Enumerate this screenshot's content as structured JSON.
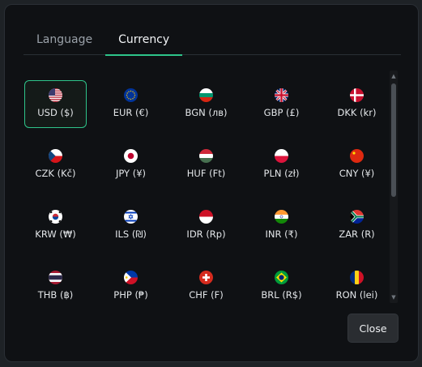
{
  "tabs": [
    {
      "label": "Language",
      "active": false
    },
    {
      "label": "Currency",
      "active": true
    }
  ],
  "accent_color": "#2ec48a",
  "currencies": [
    {
      "code": "USD ($)",
      "flag": "us-flag-icon",
      "selected": true
    },
    {
      "code": "EUR (€)",
      "flag": "eu-flag-icon"
    },
    {
      "code": "BGN (лв)",
      "flag": "bg-flag-icon"
    },
    {
      "code": "GBP (£)",
      "flag": "gb-flag-icon"
    },
    {
      "code": "DKK (kr)",
      "flag": "dk-flag-icon"
    },
    {
      "code": "CZK (Kč)",
      "flag": "cz-flag-icon"
    },
    {
      "code": "JPY (¥)",
      "flag": "jp-flag-icon"
    },
    {
      "code": "HUF (Ft)",
      "flag": "hu-flag-icon"
    },
    {
      "code": "PLN (zł)",
      "flag": "pl-flag-icon"
    },
    {
      "code": "CNY (¥)",
      "flag": "cn-flag-icon"
    },
    {
      "code": "KRW (₩)",
      "flag": "kr-flag-icon"
    },
    {
      "code": "ILS (₪)",
      "flag": "il-flag-icon"
    },
    {
      "code": "IDR (Rp)",
      "flag": "id-flag-icon"
    },
    {
      "code": "INR (₹)",
      "flag": "in-flag-icon"
    },
    {
      "code": "ZAR (R)",
      "flag": "za-flag-icon"
    },
    {
      "code": "THB (฿)",
      "flag": "th-flag-icon"
    },
    {
      "code": "PHP (₱)",
      "flag": "ph-flag-icon"
    },
    {
      "code": "CHF (F)",
      "flag": "ch-flag-icon"
    },
    {
      "code": "BRL (R$)",
      "flag": "br-flag-icon"
    },
    {
      "code": "RON (lei)",
      "flag": "ro-flag-icon"
    }
  ],
  "close_label": "Close"
}
